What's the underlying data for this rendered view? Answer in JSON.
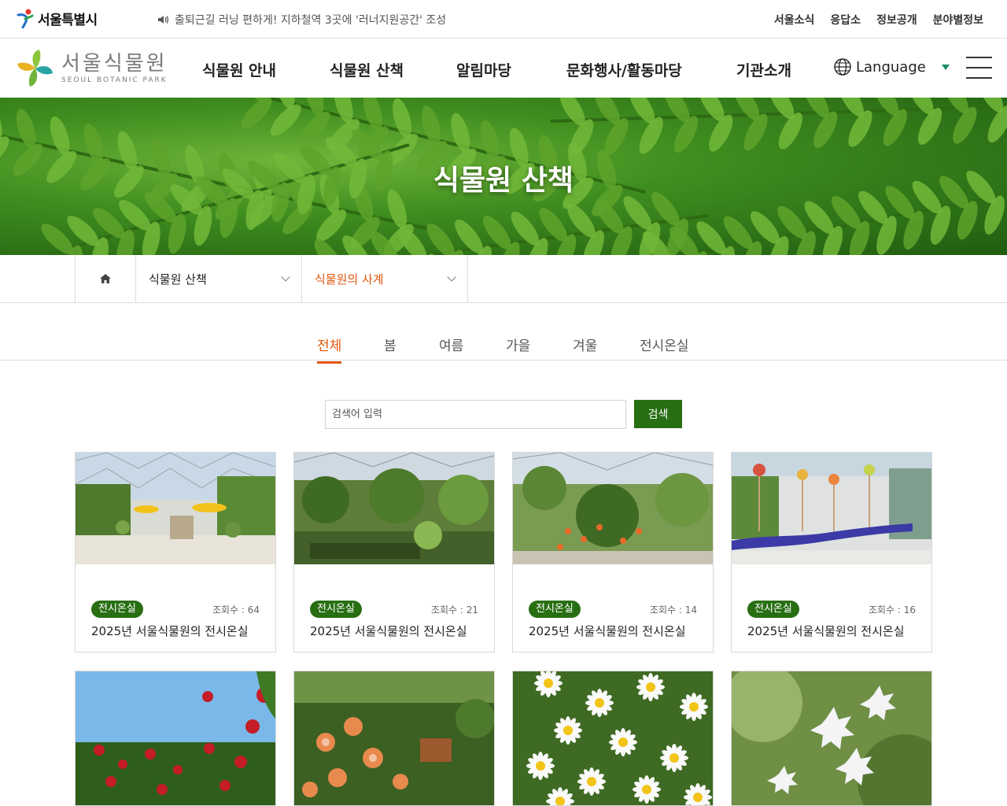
{
  "top_bar": {
    "brand_label": "서울특별시",
    "notice": "출퇴근길 러닝 편하게! 지하철역 3곳에 '러너지원공간' 조성",
    "links": [
      "서울소식",
      "응답소",
      "정보공개",
      "분야별정보"
    ]
  },
  "header": {
    "logo_name": "서울식물원",
    "logo_sub": "SEOUL BOTANIC PARK",
    "nav": [
      "식물원 안내",
      "식물원 산책",
      "알림마당",
      "문화행사/활동마당",
      "기관소개"
    ],
    "language_label": "Language"
  },
  "hero": {
    "title": "식물원 산책"
  },
  "breadcrumb": {
    "level1": "식물원 산책",
    "level2": "식물원의 사계"
  },
  "tabs": [
    {
      "label": "전체",
      "active": true
    },
    {
      "label": "봄",
      "active": false
    },
    {
      "label": "여름",
      "active": false
    },
    {
      "label": "가을",
      "active": false
    },
    {
      "label": "겨울",
      "active": false
    },
    {
      "label": "전시온실",
      "active": false
    }
  ],
  "search": {
    "placeholder": "검색어 입력",
    "button_label": "검색"
  },
  "cards": [
    {
      "badge": "전시온실",
      "views": "조회수 : 64",
      "title": "2025년 서울식물원의 전시온실",
      "scene": "greenhouse-plaza"
    },
    {
      "badge": "전시온실",
      "views": "조회수 : 21",
      "title": "2025년 서울식물원의 전시온실",
      "scene": "greenhouse-pond"
    },
    {
      "badge": "전시온실",
      "views": "조회수 : 14",
      "title": "2025년 서울식물원의 전시온실",
      "scene": "greenhouse-flowers"
    },
    {
      "badge": "전시온실",
      "views": "조회수 : 16",
      "title": "2025년 서울식물원의 전시온실",
      "scene": "greenhouse-art"
    },
    {
      "scene": "red-roses"
    },
    {
      "scene": "orange-roses"
    },
    {
      "scene": "white-daisies"
    },
    {
      "scene": "white-blossoms"
    }
  ],
  "colors": {
    "accent_orange": "#e0560b",
    "brand_green": "#286f14",
    "language_caret": "#1b8a6b"
  }
}
